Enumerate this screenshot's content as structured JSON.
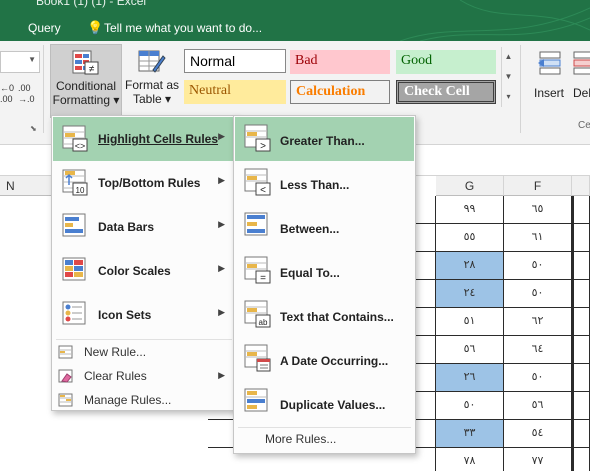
{
  "window": {
    "title": "Book1 (1) (1) - Excel"
  },
  "tellbar": {
    "query_label": "Query",
    "tell_me_placeholder": "Tell me what you want to do..."
  },
  "ribbon": {
    "conditional_formatting": {
      "line1": "Conditional",
      "line2": "Formatting ▾"
    },
    "format_as_table": {
      "line1": "Format as",
      "line2": "Table ▾"
    },
    "styles": [
      {
        "label": "Normal",
        "kind": "normal"
      },
      {
        "label": "Bad",
        "kind": "bad"
      },
      {
        "label": "Good",
        "kind": "good"
      },
      {
        "label": "Neutral",
        "kind": "neutral"
      },
      {
        "label": "Calculation",
        "kind": "calculation"
      },
      {
        "label": "Check Cell",
        "kind": "check"
      }
    ],
    "insert_label": "Insert",
    "delete_label": "Dele",
    "cells_group_label": "Ce"
  },
  "column_headers": {
    "n": "N",
    "g": "G",
    "f": "F"
  },
  "grid": {
    "rows": [
      {
        "g": "٩٩",
        "f": "٦٥",
        "g_highlight": false
      },
      {
        "g": "٥٥",
        "f": "٦١",
        "g_highlight": false
      },
      {
        "g": "٢٨",
        "f": "٥٠",
        "g_highlight": true
      },
      {
        "g": "٢٤",
        "f": "٥٠",
        "g_highlight": true
      },
      {
        "g": "٥١",
        "f": "٦٢",
        "g_highlight": false
      },
      {
        "g": "٥٦",
        "f": "٦٤",
        "g_highlight": false
      },
      {
        "g": "٢٦",
        "f": "٥٠",
        "g_highlight": true
      },
      {
        "g": "٥٠",
        "f": "٥٦",
        "g_highlight": false
      },
      {
        "g": "٣٣",
        "f": "٥٤",
        "g_highlight": true
      },
      {
        "g": "٧٨",
        "f": "٧٧",
        "g_highlight": false
      }
    ]
  },
  "menu": {
    "items": [
      {
        "label": "Highlight Cells Rules",
        "icon": "highlight-cells-icon",
        "has_submenu": true,
        "active": true
      },
      {
        "label": "Top/Bottom Rules",
        "icon": "top-bottom-icon",
        "has_submenu": true,
        "active": false
      },
      {
        "label": "Data Bars",
        "icon": "data-bars-icon",
        "has_submenu": true,
        "active": false
      },
      {
        "label": "Color Scales",
        "icon": "color-scales-icon",
        "has_submenu": true,
        "active": false
      },
      {
        "label": "Icon Sets",
        "icon": "icon-sets-icon",
        "has_submenu": true,
        "active": false
      }
    ],
    "new_rule": "New Rule...",
    "clear_rules": "Clear Rules",
    "manage_rules": "Manage Rules...",
    "top_bottom_badge": "10"
  },
  "submenu": {
    "items": [
      {
        "label": "Greater Than...",
        "icon": "greater-than-icon",
        "active": true
      },
      {
        "label": "Less Than...",
        "icon": "less-than-icon",
        "active": false
      },
      {
        "label": "Between...",
        "icon": "between-icon",
        "active": false
      },
      {
        "label": "Equal To...",
        "icon": "equal-to-icon",
        "active": false
      },
      {
        "label": "Text that Contains...",
        "icon": "text-contains-icon",
        "active": false
      },
      {
        "label": "A Date Occurring...",
        "icon": "date-occurring-icon",
        "active": false
      },
      {
        "label": "Duplicate Values...",
        "icon": "duplicate-values-icon",
        "active": false
      }
    ],
    "more_rules": "More Rules..."
  },
  "colors": {
    "excel_green": "#217346",
    "menu_highlight": "#a3d2b1",
    "cell_highlight": "#9dc3e6"
  }
}
